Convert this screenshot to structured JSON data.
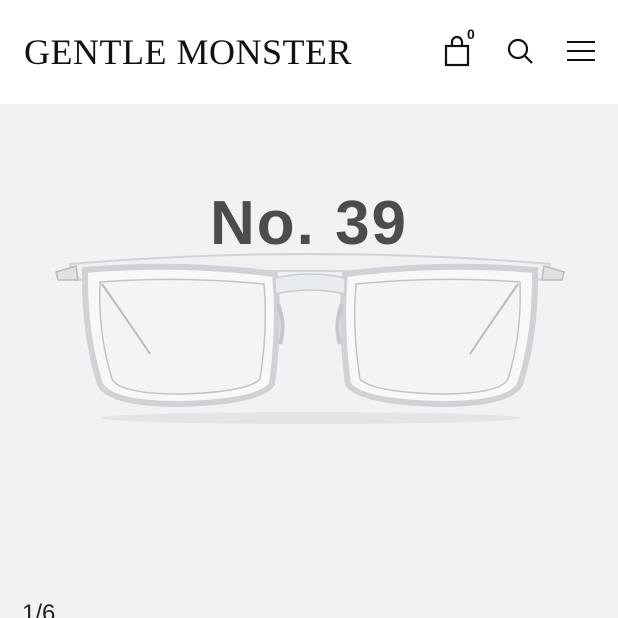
{
  "header": {
    "brand": "GENTLE MONSTER",
    "cart_count": "0",
    "icons": [
      "shopping-bag-icon",
      "search-icon",
      "menu-icon"
    ]
  },
  "product": {
    "name": "No. 39",
    "image": "clear-frame-eyeglasses"
  },
  "gallery": {
    "pager": "1/6"
  },
  "colors": {
    "stage_background": "#f1f2f4",
    "title": "#4a4c4e"
  }
}
